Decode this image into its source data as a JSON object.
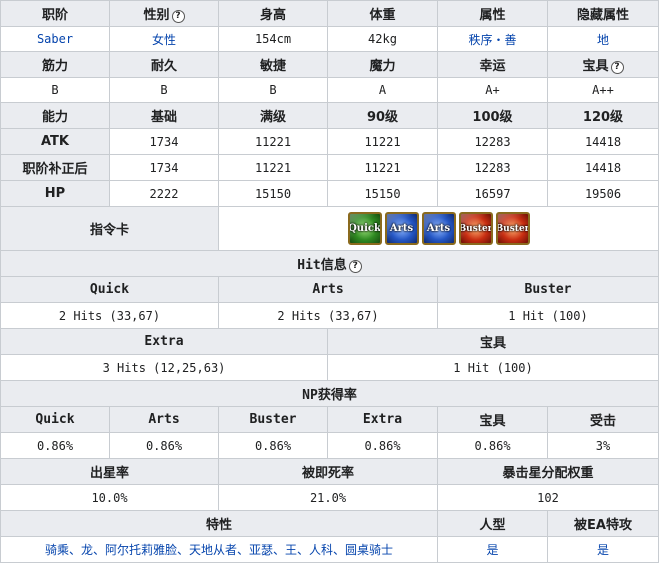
{
  "row1": {
    "headers": [
      "职阶",
      "性别",
      "身高",
      "体重",
      "属性",
      "隐藏属性"
    ],
    "values": [
      "Saber",
      "女性",
      "154cm",
      "42kg",
      "秩序・善",
      "地"
    ]
  },
  "row2": {
    "headers": [
      "筋力",
      "耐久",
      "敏捷",
      "魔力",
      "幸运",
      "宝具"
    ],
    "values": [
      "B",
      "B",
      "B",
      "A",
      "A+",
      "A++"
    ]
  },
  "stats": {
    "headers": [
      "能力",
      "基础",
      "满级",
      "90级",
      "100级",
      "120级"
    ],
    "rows": [
      {
        "label": "ATK",
        "values": [
          "1734",
          "11221",
          "11221",
          "12283",
          "14418"
        ]
      },
      {
        "label": "职阶补正后",
        "values": [
          "1734",
          "11221",
          "11221",
          "12283",
          "14418"
        ]
      },
      {
        "label": "HP",
        "values": [
          "2222",
          "15150",
          "15150",
          "16597",
          "19506"
        ]
      }
    ]
  },
  "command_cards": {
    "label": "指令卡",
    "cards": [
      {
        "type": "quick",
        "text": "Quick",
        "icon": "quick-card-icon"
      },
      {
        "type": "arts",
        "text": "Arts",
        "icon": "arts-card-icon"
      },
      {
        "type": "arts",
        "text": "Arts",
        "icon": "arts-card-icon"
      },
      {
        "type": "buster",
        "text": "Buster",
        "icon": "buster-card-icon"
      },
      {
        "type": "buster",
        "text": "Buster",
        "icon": "buster-card-icon"
      }
    ]
  },
  "hits": {
    "title": "Hit信息",
    "row1_headers": [
      "Quick",
      "Arts",
      "Buster"
    ],
    "row1_values": [
      "2 Hits (33,67)",
      "2 Hits (33,67)",
      "1 Hit (100)"
    ],
    "row2_headers": [
      "Extra",
      "宝具"
    ],
    "row2_values": [
      "3 Hits (12,25,63)",
      "1 Hit (100)"
    ]
  },
  "np": {
    "title": "NP获得率",
    "headers": [
      "Quick",
      "Arts",
      "Buster",
      "Extra",
      "宝具",
      "受击"
    ],
    "values": [
      "0.86%",
      "0.86%",
      "0.86%",
      "0.86%",
      "0.86%",
      "3%"
    ]
  },
  "stars": {
    "headers": [
      "出星率",
      "被即死率",
      "暴击星分配权重"
    ],
    "values": [
      "10.0%",
      "21.0%",
      "102"
    ]
  },
  "traits": {
    "headers": [
      "特性",
      "人型",
      "被EA特攻"
    ],
    "values": [
      "骑乘、龙、阿尔托莉雅脸、天地从者、亚瑟、王、人科、圆桌骑士",
      "是",
      "是"
    ]
  },
  "help_icon": "question-circle-icon",
  "colors": {
    "header_bg": "#eaecf0",
    "border": "#c8ccd1",
    "link": "#0645ad"
  }
}
